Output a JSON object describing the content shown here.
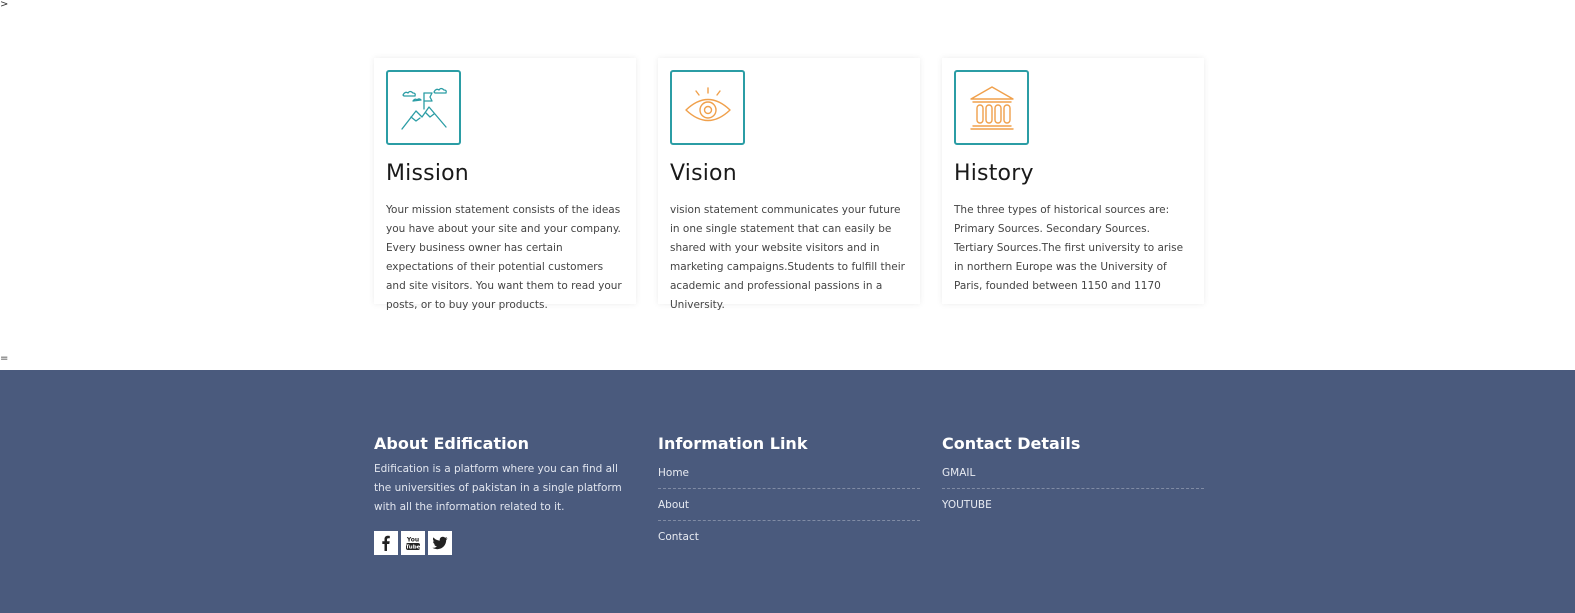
{
  "stray_marks": {
    "top": ">",
    "middle": "="
  },
  "cards": [
    {
      "icon": "mountain-flag-icon",
      "title": "Mission",
      "text": "Your mission statement consists of the ideas you have about your site and your company. Every business owner has certain expectations of their potential customers and site visitors. You want them to read your posts, or to buy your products."
    },
    {
      "icon": "eye-icon",
      "title": "Vision",
      "text": "vision statement communicates your future in one single statement that can easily be shared with your website visitors and in marketing campaigns.Students to fulfill their academic and professional passions in a University."
    },
    {
      "icon": "museum-icon",
      "title": "History",
      "text": "The three types of historical sources are: Primary Sources. Secondary Sources. Tertiary Sources.The first university to arise in northern Europe was the University of Paris, founded between 1150 and 1170"
    }
  ],
  "footer": {
    "about": {
      "heading": "About Edification",
      "text": "Edification is a platform where you can find all the universities of pakistan in a single platform with all the information related to it.",
      "social": [
        "facebook-icon",
        "youtube-icon",
        "twitter-icon"
      ]
    },
    "info": {
      "heading": "Information Link",
      "links": [
        "Home",
        "About",
        "Contact"
      ]
    },
    "contact": {
      "heading": "Contact Details",
      "links": [
        "GMAIL",
        "YOUTUBE"
      ]
    }
  },
  "colors": {
    "teal_accent": "#2b9da5",
    "orange_accent": "#f0a04b",
    "footer_bg": "#4a5a7d"
  }
}
